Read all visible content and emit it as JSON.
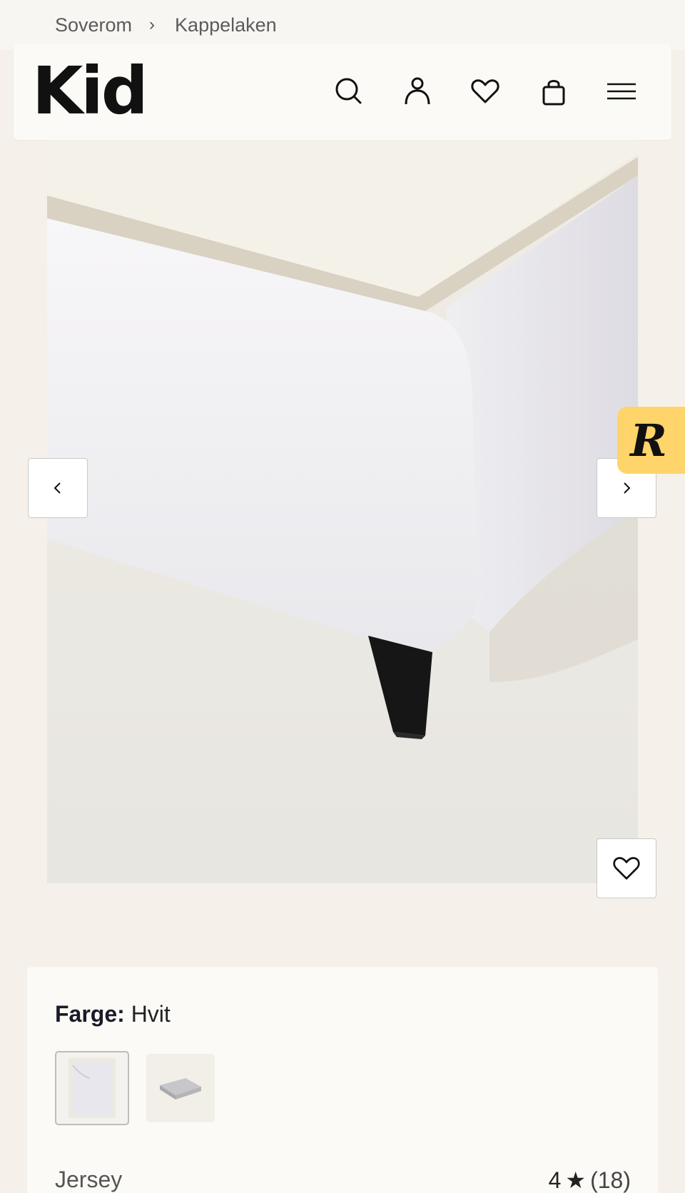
{
  "breadcrumb": {
    "items": [
      "Soverom",
      "Kappelaken"
    ],
    "separator": "›"
  },
  "header": {
    "logo": "Kid",
    "icons": [
      "search-icon",
      "user-icon",
      "heart-icon",
      "bag-icon",
      "menu-icon"
    ]
  },
  "gallery": {
    "prev_icon": "chevron-left-icon",
    "next_icon": "chevron-right-icon",
    "favorite_icon": "heart-icon"
  },
  "floating_badge": {
    "letter": "R",
    "color": "#ffd46a"
  },
  "product": {
    "color_label": "Farge:",
    "color_value": "Hvit",
    "material": "Jersey",
    "rating": "4",
    "rating_star": "★",
    "review_count": "(18)"
  },
  "colors": {
    "background": "#f5f1ea",
    "card": "#fbfaf6",
    "accent": "#ffd46a"
  }
}
